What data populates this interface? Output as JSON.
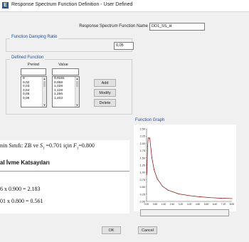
{
  "window": {
    "title": "Response Spectrum Function Definition - User Defined",
    "icon_letter": "E"
  },
  "function_name": {
    "label": "Response Spectrum Function Name",
    "value": "DD1_SS_H"
  },
  "damping": {
    "group_title": "Function Damping Ratio",
    "value": "0,05"
  },
  "defined_function": {
    "group_title": "Defined Function",
    "col_period": "Period",
    "col_value": "Value",
    "periods": [
      "0",
      "0,02",
      "0,03",
      "0,04",
      "0,05",
      "0,06"
    ],
    "values": [
      "0,9181",
      "0,958",
      "1,028",
      "1,128",
      "1,256",
      "1,403"
    ]
  },
  "buttons": {
    "add": "Add",
    "modify": "Modify",
    "delete": "Delete",
    "ok": "OK",
    "cancel": "Cancel"
  },
  "overlay": {
    "line1_prefix": "nin Sınıfı: ZB ve ",
    "line1_sym": "S",
    "line1_sub": "1",
    "line1_mid": " =0.701 için ",
    "line1_sym2": "F",
    "line1_sub2": "1",
    "line1_end": "=0.800",
    "heading": "al İvme Katsayıları",
    "eq1": "6 x 0.900 = 2.183",
    "eq2": "01 x 0.800 = 0.561"
  },
  "chart_data": {
    "type": "line",
    "title": "Function Graph",
    "xlabel": "",
    "ylabel": "",
    "y_ticks": [
      "2.50",
      "2.25",
      "2.00",
      "1.75",
      "1.50",
      "1.25",
      "1.00",
      "0.75",
      "0.50",
      "0.25",
      "0.00"
    ],
    "x_ticks": [
      "0.00",
      "0.80",
      "1.60",
      "2.40",
      "3.20",
      "4.00",
      "4.80",
      "5.60",
      "6.40",
      "7.20",
      "8.00"
    ],
    "xlim": [
      0,
      8
    ],
    "ylim": [
      0,
      2.5
    ],
    "grid": false,
    "series": [
      {
        "x": [
          0,
          0.02,
          0.03,
          0.04,
          0.05,
          0.06,
          0.1,
          0.15,
          0.2,
          0.3,
          0.5,
          0.7,
          1.0,
          1.5,
          2.0,
          3.0,
          4.0,
          5.0,
          6.0,
          7.0,
          8.0
        ],
        "y": [
          0.9181,
          0.958,
          1.028,
          1.128,
          1.256,
          1.403,
          1.9,
          2.183,
          2.183,
          2.183,
          1.5,
          1.1,
          0.78,
          0.52,
          0.39,
          0.26,
          0.2,
          0.16,
          0.13,
          0.11,
          0.1
        ]
      }
    ]
  }
}
